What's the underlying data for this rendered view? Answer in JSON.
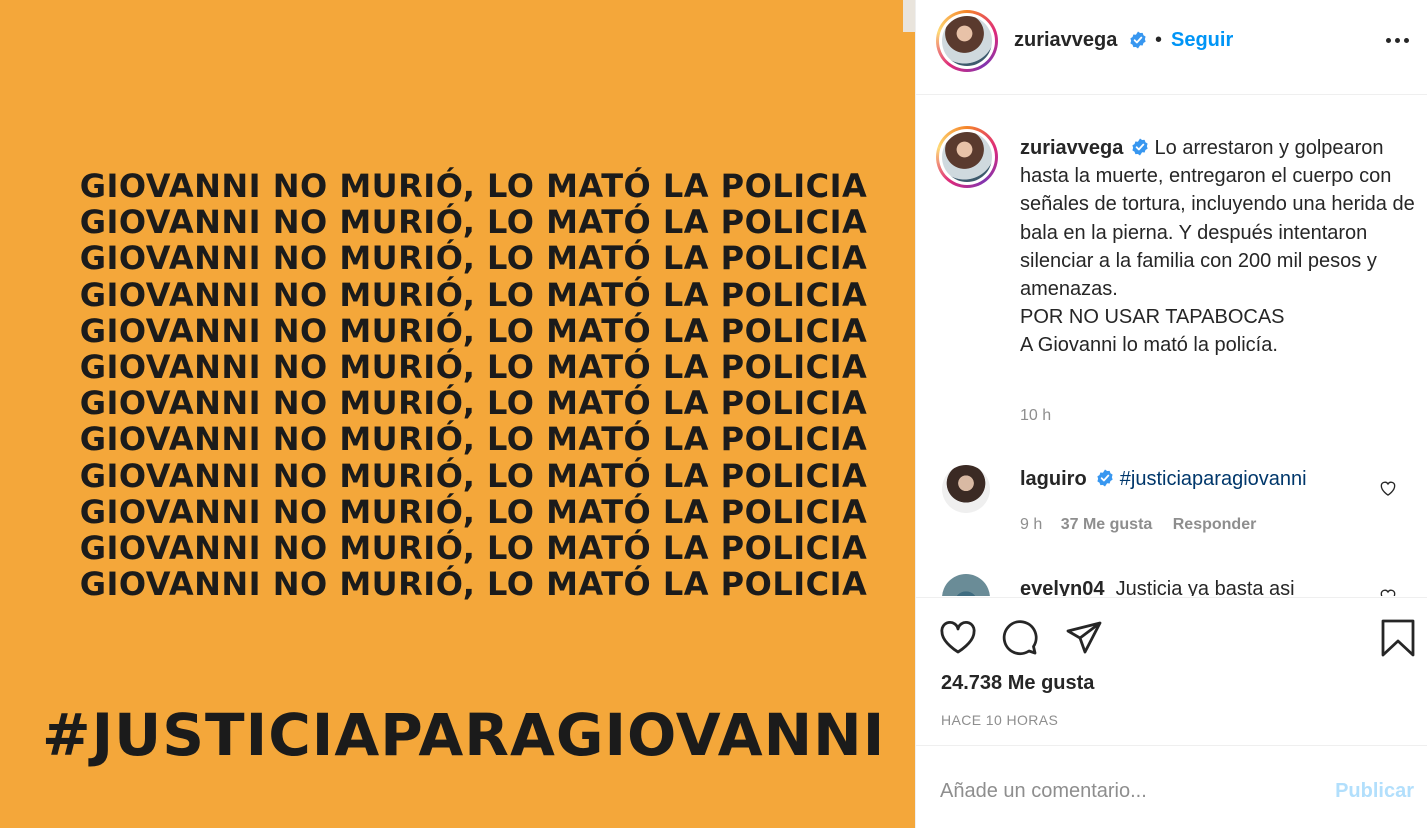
{
  "image": {
    "background_color": "#f4a73a",
    "slogan_lines": [
      "GIOVANNI NO MURIÓ, LO MATÓ LA POLICIA",
      "GIOVANNI NO MURIÓ, LO MATÓ LA POLICIA",
      "GIOVANNI NO MURIÓ, LO MATÓ LA POLICIA",
      "GIOVANNI NO MURIÓ, LO MATÓ LA POLICIA",
      "GIOVANNI NO MURIÓ, LO MATÓ LA POLICIA",
      "GIOVANNI NO MURIÓ, LO MATÓ LA POLICIA",
      "GIOVANNI NO MURIÓ, LO MATÓ LA POLICIA",
      "GIOVANNI NO MURIÓ, LO MATÓ LA POLICIA",
      "GIOVANNI NO MURIÓ, LO MATÓ LA POLICIA",
      "GIOVANNI NO MURIÓ, LO MATÓ LA POLICIA",
      "GIOVANNI NO MURIÓ, LO MATÓ LA POLICIA",
      "GIOVANNI NO MURIÓ, LO MATÓ LA POLICIA"
    ],
    "hashtag": "#JUSTICIAPARAGIOVANNI"
  },
  "header": {
    "username": "zuriavvega",
    "separator": "•",
    "follow_label": "Seguir",
    "more_icon": "more-horizontal-icon"
  },
  "caption": {
    "username": "zuriavvega",
    "text_lines": [
      "Lo arrestaron y golpearon hasta la muerte, entregaron el cuerpo con señales de tortura, incluyendo una herida de bala en la pierna. Y después intentaron silenciar a la familia con 200 mil pesos y amenazas.",
      "POR NO USAR TAPABOCAS",
      "A Giovanni lo mató la policía."
    ],
    "time": "10 h"
  },
  "comments": [
    {
      "username": "laguiro",
      "text": "#justiciaparagiovanni",
      "time": "9 h",
      "likes": "37 Me gusta",
      "reply_label": "Responder"
    },
    {
      "username": "evelyn04",
      "text": "Justicia ya basta asi"
    }
  ],
  "actions": {
    "icons": [
      "heart-icon",
      "comment-icon",
      "share-icon",
      "bookmark-icon"
    ],
    "likes_total": "24.738 Me gusta",
    "time_ago": "HACE 10 HORAS"
  },
  "add_comment": {
    "placeholder": "Añade un comentario...",
    "publish_label": "Publicar"
  },
  "colors": {
    "accent": "#0095f6",
    "link": "#00376b",
    "muted": "#8e8e8e",
    "publish_disabled": "#b2dffc"
  }
}
